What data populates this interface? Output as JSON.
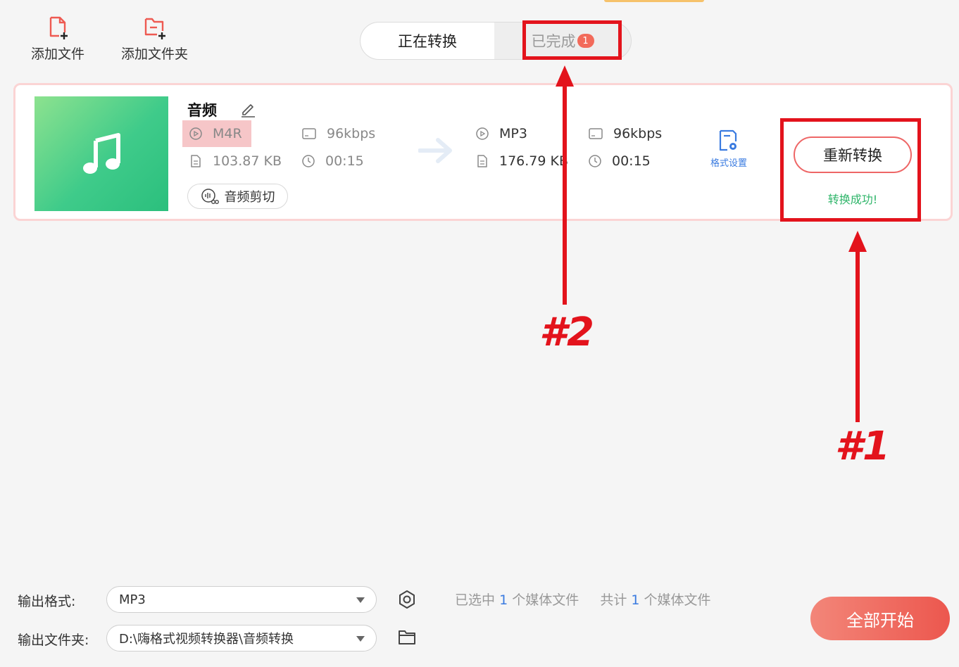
{
  "toolbar": {
    "add_file": "添加文件",
    "add_folder": "添加文件夹"
  },
  "tabs": {
    "converting": "正在转换",
    "done": "已完成",
    "done_badge": "1"
  },
  "file": {
    "name": "音频",
    "source": {
      "format": "M4R",
      "bitrate": "96kbps",
      "size": "103.87 KB",
      "duration": "00:15"
    },
    "target": {
      "format": "MP3",
      "bitrate": "96kbps",
      "size": "176.79 KB",
      "duration": "00:15"
    },
    "trim_label": "音频剪切",
    "format_settings_label": "格式设置",
    "reconvert_label": "重新转换",
    "status": "转换成功!"
  },
  "annotations": {
    "label1": "#1",
    "label2": "#2"
  },
  "bottom": {
    "output_format_label": "输出格式:",
    "output_format_value": "MP3",
    "output_folder_label": "输出文件夹:",
    "output_folder_value": "D:\\嗨格式视频转换器\\音频转换",
    "selected_prefix": "已选中",
    "selected_count": "1",
    "selected_suffix": "个媒体文件",
    "total_prefix": "共计",
    "total_count": "1",
    "total_suffix": "个媒体文件",
    "start_all": "全部开始"
  },
  "colors": {
    "accent_red": "#e3131c",
    "brand_gradient_start": "#f38679",
    "brand_gradient_end": "#ec574e",
    "success_green": "#2fb56a",
    "link_blue": "#3a7be0"
  },
  "icons": [
    "add-file-icon",
    "add-folder-icon",
    "music-note-icon",
    "edit-pencil-icon",
    "disc-format-icon",
    "resolution-icon",
    "file-size-icon",
    "clock-icon",
    "arrow-right-icon",
    "audio-trim-icon",
    "format-settings-icon",
    "settings-gear-icon",
    "folder-open-icon"
  ]
}
